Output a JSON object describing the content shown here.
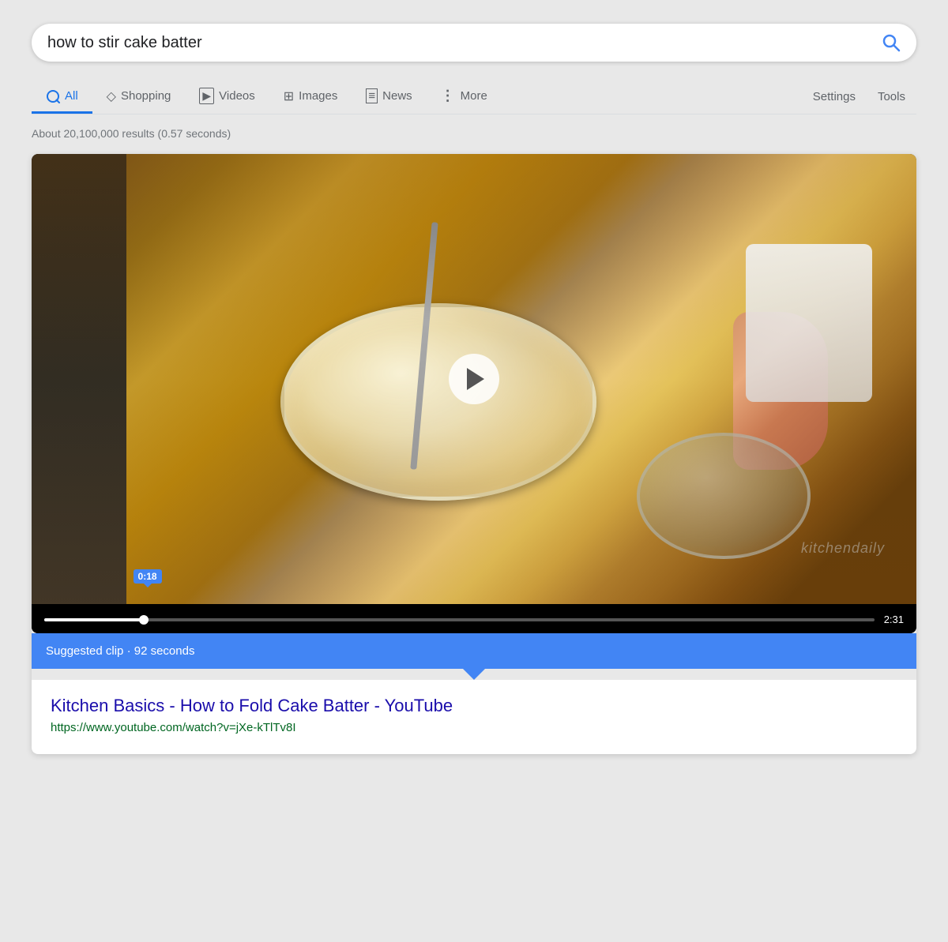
{
  "search": {
    "query": "how to stir cake batter",
    "placeholder": "how to stir cake batter"
  },
  "tabs": [
    {
      "id": "all",
      "label": "All",
      "icon": "🔍",
      "active": true
    },
    {
      "id": "shopping",
      "label": "Shopping",
      "icon": "◇"
    },
    {
      "id": "videos",
      "label": "Videos",
      "icon": "▶"
    },
    {
      "id": "images",
      "label": "Images",
      "icon": "⊞"
    },
    {
      "id": "news",
      "label": "News",
      "icon": "≡"
    },
    {
      "id": "more",
      "label": "More",
      "icon": "⋮"
    }
  ],
  "settings_label": "Settings",
  "tools_label": "Tools",
  "results_count": "About 20,100,000 results (0.57 seconds)",
  "video": {
    "timestamp_current": "0:18",
    "duration": "2:31",
    "watermark": "kitchendaily",
    "suggested_clip_text": "Suggested clip · 92 seconds",
    "progress_percent": 12
  },
  "result": {
    "title": "Kitchen Basics - How to Fold Cake Batter - YouTube",
    "url": "https://www.youtube.com/watch?v=jXe-kTlTv8I"
  }
}
